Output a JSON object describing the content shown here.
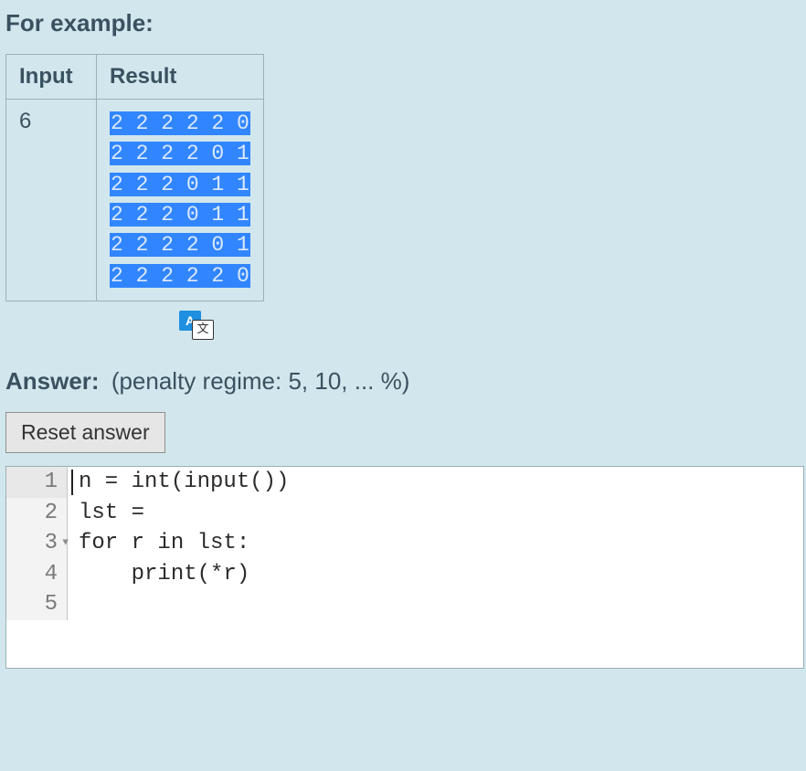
{
  "example": {
    "heading": "For example:",
    "headers": {
      "input": "Input",
      "result": "Result"
    },
    "input_value": "6",
    "result_rows": [
      "2 2 2 2 2 0",
      "2 2 2 2 0 1",
      "2 2 2 0 1 1",
      "2 2 2 0 1 1",
      "2 2 2 2 0 1",
      "2 2 2 2 2 0"
    ]
  },
  "translate_icon": {
    "front": "A",
    "back": "文"
  },
  "answer": {
    "label": "Answer:",
    "penalty": "(penalty regime: 5, 10, ... %)"
  },
  "reset_button": "Reset answer",
  "editor": {
    "lines": [
      {
        "num": "1",
        "code": "n = int(input())",
        "fold": false
      },
      {
        "num": "2",
        "code": "lst =",
        "fold": false
      },
      {
        "num": "3",
        "code": "for r in lst:",
        "fold": true
      },
      {
        "num": "4",
        "code": "    print(*r)",
        "fold": false
      },
      {
        "num": "5",
        "code": "",
        "fold": false
      }
    ]
  }
}
